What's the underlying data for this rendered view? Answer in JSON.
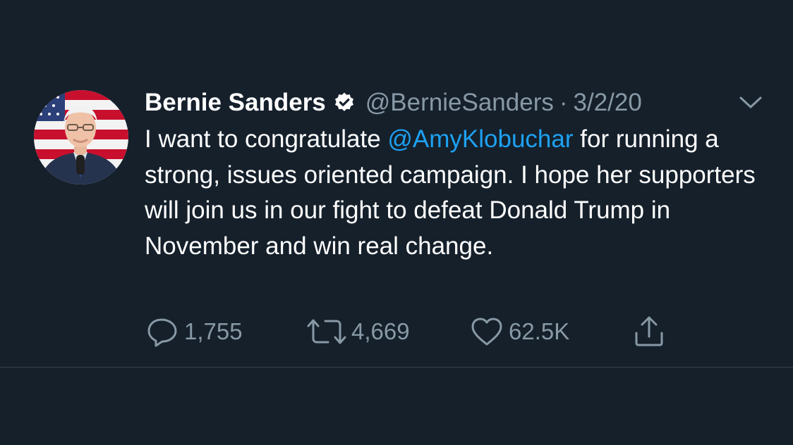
{
  "tweet": {
    "author_name": "Bernie Sanders",
    "handle": "@BernieSanders",
    "separator": "·",
    "date": "3/2/20",
    "text_before": "I want to congratulate ",
    "mention": "@AmyKlobuchar",
    "text_after": " for running a strong, issues oriented campaign. I hope her supporters will join us in our fight to defeat Donald Trump in November and win real change."
  },
  "actions": {
    "reply_count": "1,755",
    "retweet_count": "4,669",
    "like_count": "62.5K"
  },
  "icons": {
    "avatar": "avatar",
    "verified": "verified-badge-icon",
    "caret": "chevron-down-icon",
    "reply": "reply-icon",
    "retweet": "retweet-icon",
    "like": "heart-icon",
    "share": "share-icon"
  },
  "colors": {
    "background": "#15202b",
    "text": "#ffffff",
    "muted": "#8899a6",
    "accent": "#1da1f2",
    "divider": "#38444d"
  }
}
